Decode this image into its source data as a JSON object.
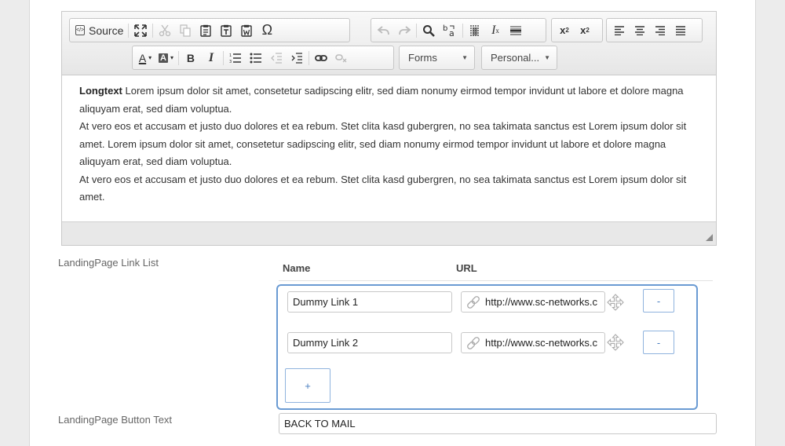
{
  "editor": {
    "toolbar": {
      "source_label": "Source",
      "forms_label": "Forms",
      "personal_label": "Personal..."
    },
    "content": {
      "bold_lead": "Longtext",
      "para1": " Lorem ipsum dolor sit amet, consetetur sadipscing elitr, sed diam nonumy eirmod tempor invidunt ut labore et dolore magna aliquyam erat, sed diam voluptua.",
      "para2": "At vero eos et accusam et justo duo dolores et ea rebum. Stet clita kasd gubergren, no sea takimata sanctus est Lorem ipsum dolor sit amet. Lorem ipsum dolor sit amet, consetetur sadipscing elitr, sed diam nonumy eirmod tempor invidunt ut labore et dolore magna aliquyam erat, sed diam voluptua.",
      "para3": "At vero eos et accusam et justo duo dolores et ea rebum. Stet clita kasd gubergren, no sea takimata sanctus est Lorem ipsum dolor sit amet."
    }
  },
  "link_list": {
    "label": "LandingPage Link List",
    "name_header": "Name",
    "url_header": "URL",
    "rows": [
      {
        "name": "Dummy Link 1",
        "url": "http://www.sc-networks.c",
        "remove_label": "-"
      },
      {
        "name": "Dummy Link 2",
        "url": "http://www.sc-networks.c",
        "remove_label": "-"
      }
    ],
    "add_label": "+"
  },
  "button_text": {
    "label": "LandingPage Button Text",
    "value": "BACK TO MAIL"
  },
  "colors": {
    "accent_border": "#6a9bd3",
    "button_text": "#4a7ec0"
  }
}
